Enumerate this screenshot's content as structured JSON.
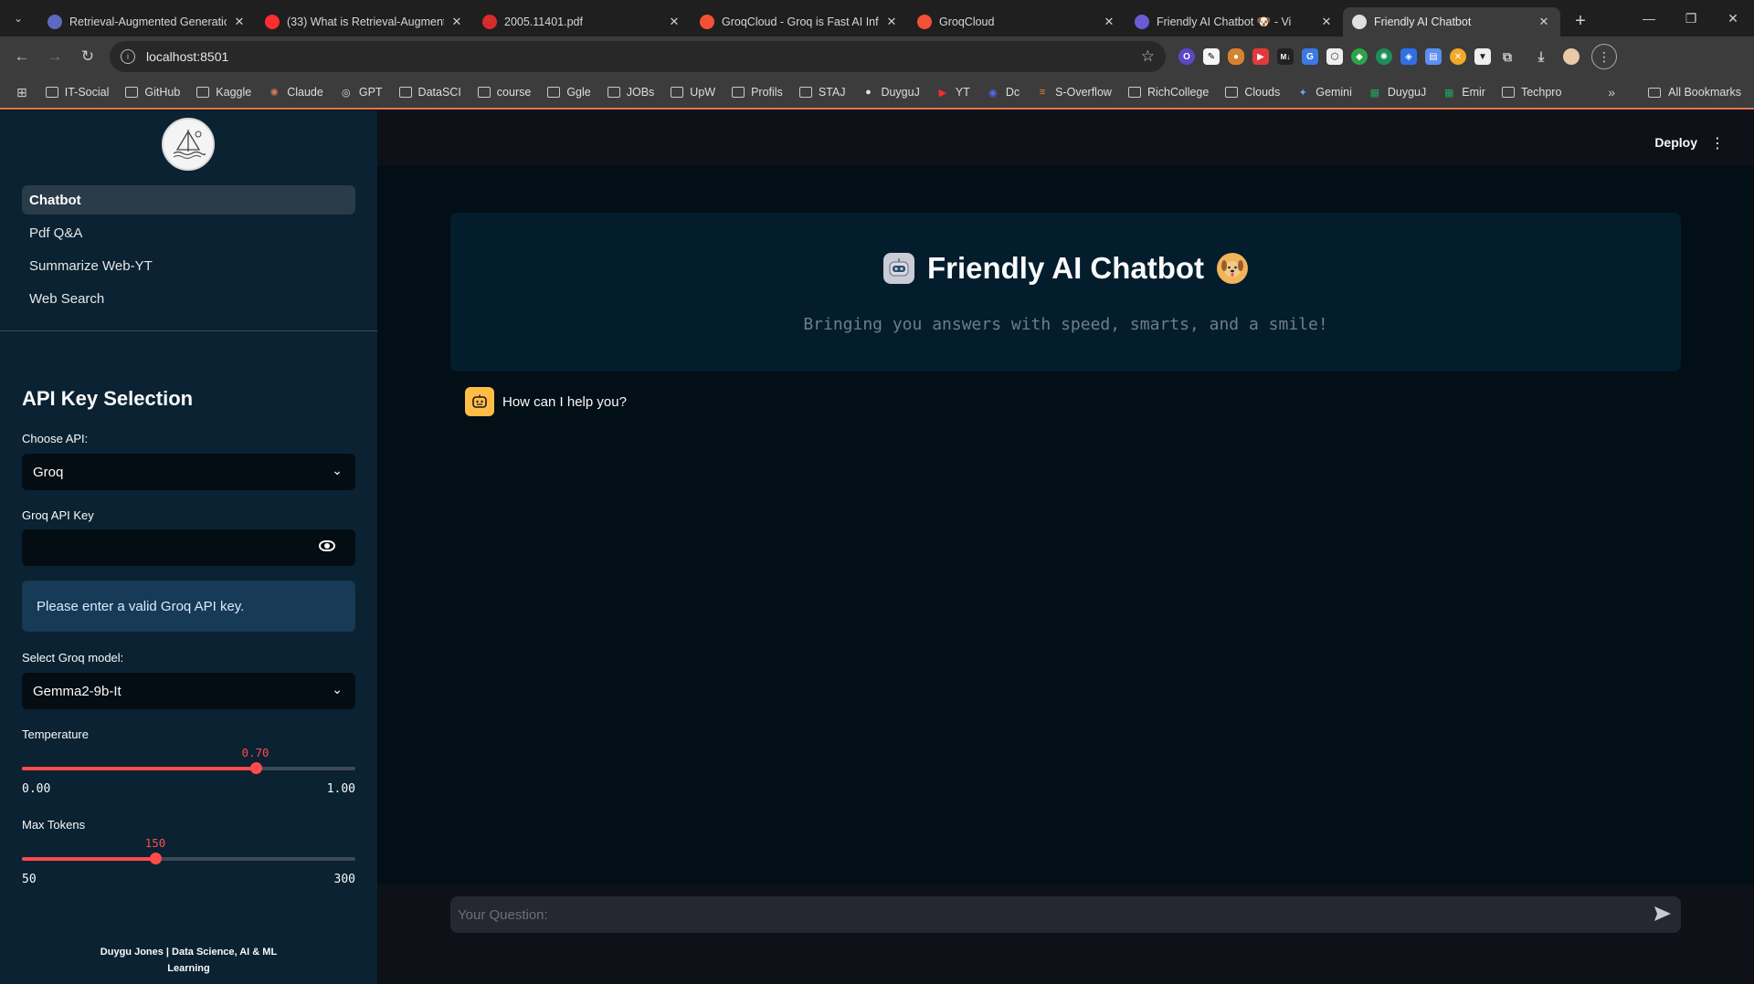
{
  "browser": {
    "tabs": [
      {
        "title": "Retrieval-Augmented Generatio",
        "favicon_color": "#5b6ac0",
        "active": false
      },
      {
        "title": "(33) What is Retrieval-Augment",
        "favicon_color": "#ff2d2d",
        "active": false
      },
      {
        "title": "2005.11401.pdf",
        "favicon_color": "#d72c2c",
        "active": false
      },
      {
        "title": "GroqCloud - Groq is Fast AI Infe",
        "favicon_color": "#f55036",
        "active": false
      },
      {
        "title": "GroqCloud",
        "favicon_color": "#f55036",
        "active": false
      },
      {
        "title": "Friendly AI Chatbot 🐶 - Vi",
        "favicon_color": "#6b5bd6",
        "active": false
      },
      {
        "title": "Friendly AI Chatbot",
        "favicon_color": "#e0e0e0",
        "active": true
      }
    ],
    "url": "localhost:8501",
    "bookmarks": [
      {
        "label": "IT-Social",
        "icon": "folder"
      },
      {
        "label": "GitHub",
        "icon": "folder"
      },
      {
        "label": "Kaggle",
        "icon": "folder"
      },
      {
        "label": "Claude",
        "icon": "claude"
      },
      {
        "label": "GPT",
        "icon": "gpt"
      },
      {
        "label": "DataSCI",
        "icon": "folder"
      },
      {
        "label": "course",
        "icon": "folder"
      },
      {
        "label": "Ggle",
        "icon": "folder"
      },
      {
        "label": "JOBs",
        "icon": "folder"
      },
      {
        "label": "UpW",
        "icon": "folder"
      },
      {
        "label": "Profils",
        "icon": "folder"
      },
      {
        "label": "STAJ",
        "icon": "folder"
      },
      {
        "label": "DuyguJ",
        "icon": "avatar"
      },
      {
        "label": "YT",
        "icon": "youtube"
      },
      {
        "label": "Dc",
        "icon": "dc"
      },
      {
        "label": "S-Overflow",
        "icon": "stackoverflow"
      },
      {
        "label": "RichCollege",
        "icon": "folder"
      },
      {
        "label": "Clouds",
        "icon": "folder"
      },
      {
        "label": "Gemini",
        "icon": "gemini"
      },
      {
        "label": "DuyguJ",
        "icon": "sheets"
      },
      {
        "label": "Emir",
        "icon": "sheets"
      },
      {
        "label": "Techpro",
        "icon": "folder"
      }
    ],
    "all_bookmarks": "All Bookmarks"
  },
  "header": {
    "deploy": "Deploy"
  },
  "sidebar": {
    "nav": [
      {
        "label": "Chatbot",
        "active": true
      },
      {
        "label": "Pdf Q&A",
        "active": false
      },
      {
        "label": "Summarize Web-YT",
        "active": false
      },
      {
        "label": "Web Search",
        "active": false
      }
    ],
    "section_title": "API Key Selection",
    "choose_api_label": "Choose API:",
    "choose_api_value": "Groq",
    "api_key_label": "Groq API Key",
    "api_key_value": "",
    "info_message": "Please enter a valid Groq API key.",
    "model_label": "Select Groq model:",
    "model_value": "Gemma2-9b-It",
    "temperature": {
      "label": "Temperature",
      "value": "0.70",
      "min": "0.00",
      "max": "1.00",
      "fraction": 0.7
    },
    "max_tokens": {
      "label": "Max Tokens",
      "value": "150",
      "min": "50",
      "max": "300",
      "fraction": 0.4
    },
    "footer_line1": "Duygu Jones | Data Science, AI & ML",
    "footer_line2": "Learning"
  },
  "main": {
    "title": "Friendly AI Chatbot",
    "subtitle": "Bringing you answers with speed, smarts, and a smile!",
    "assistant_message": "How can I help you?",
    "input_placeholder": "Your Question:"
  },
  "colors": {
    "accent": "#ff4b4b",
    "sidebar_bg": "#0a2232",
    "main_bg": "#020f17",
    "info_bg": "#173a56",
    "bot_avatar": "#ffbd45"
  }
}
